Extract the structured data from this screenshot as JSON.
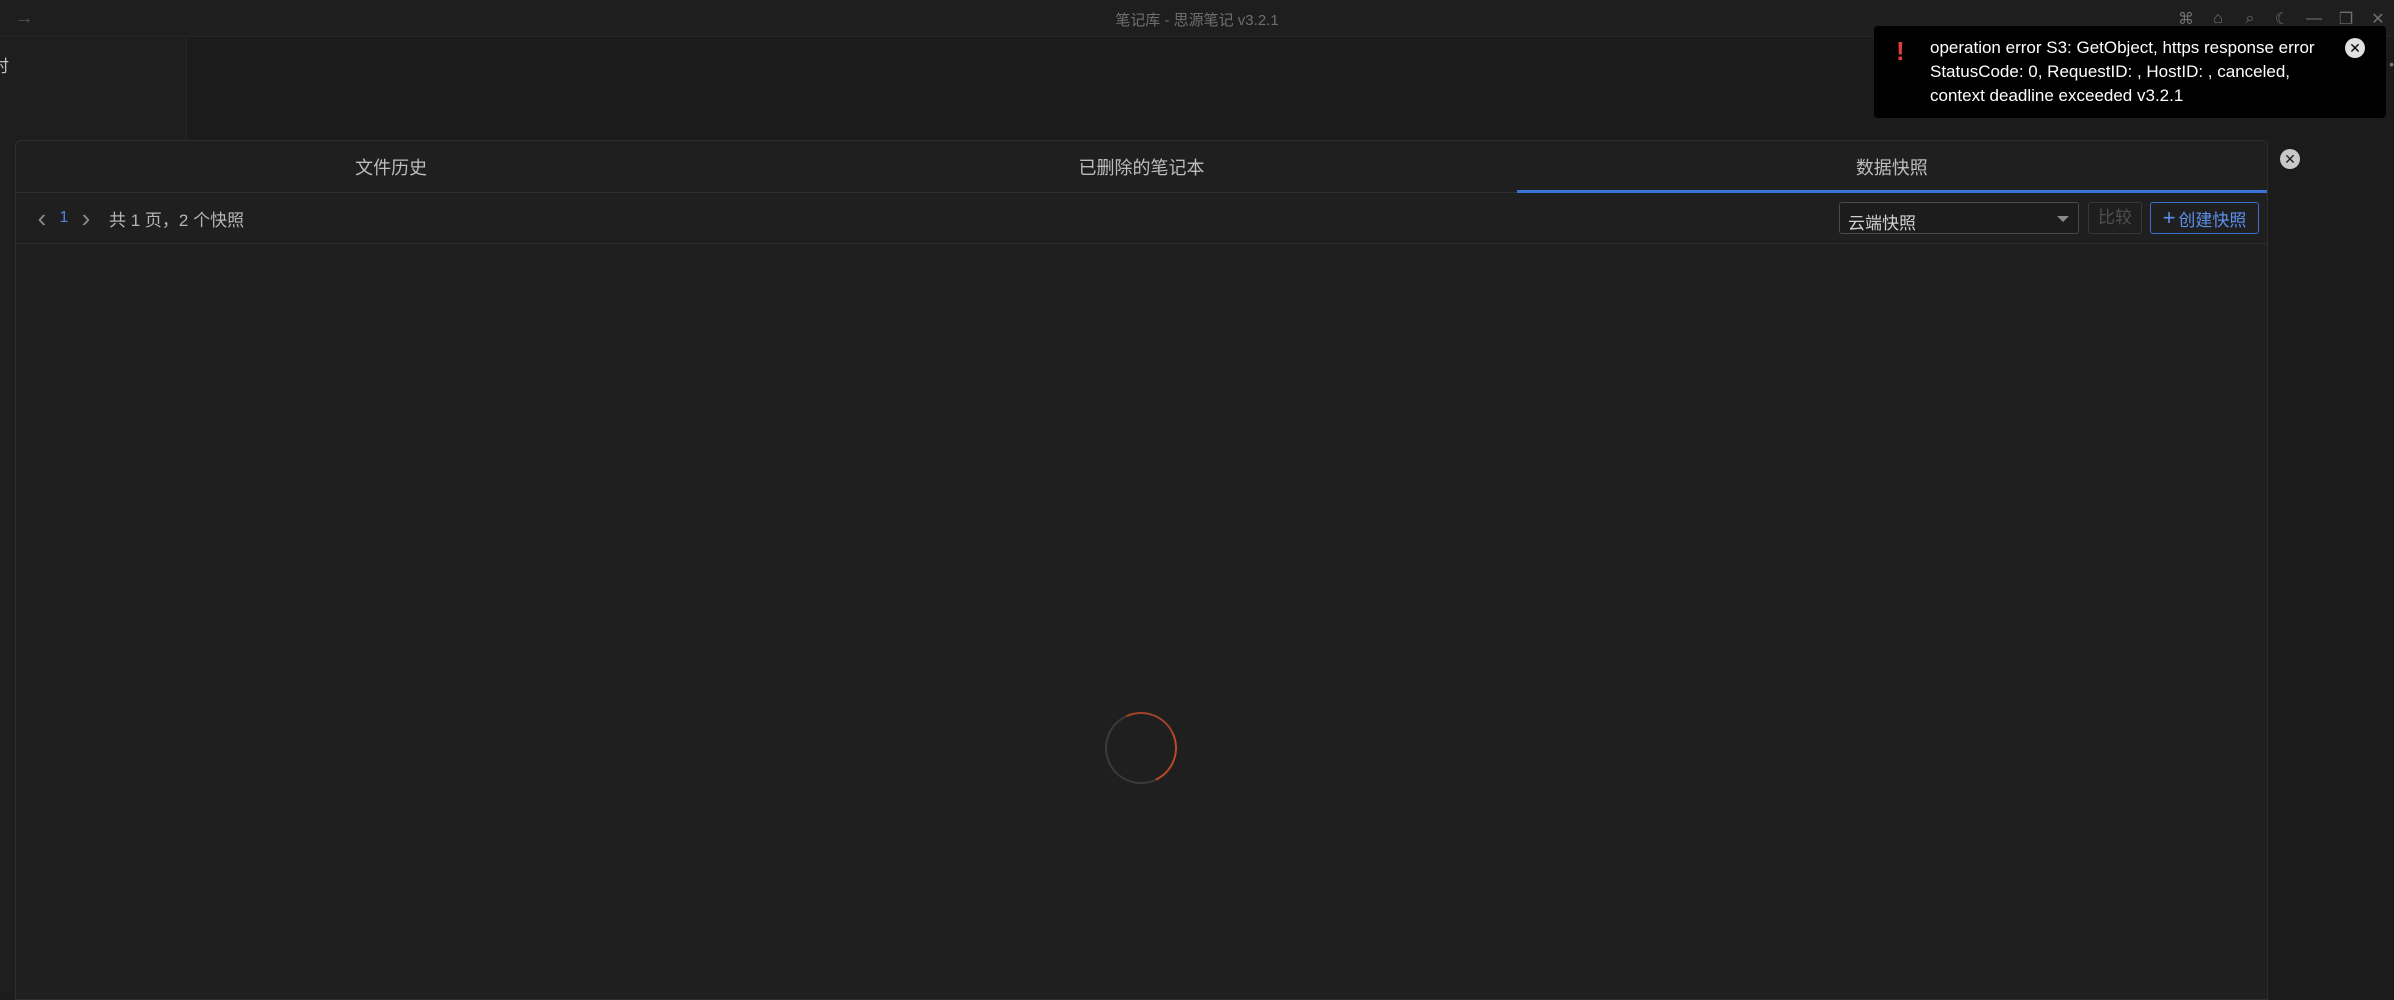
{
  "window": {
    "title": "笔记库 - 思源笔记 v3.2.1",
    "back_icon": "→",
    "icons": [
      "⌘",
      "⌂",
      "⌕",
      "☾",
      "—",
      "❐",
      "✕"
    ]
  },
  "left_panel": {
    "partial_char": "时"
  },
  "right_edge": {
    "partial_char": "•"
  },
  "tabs": [
    {
      "label": "文件历史",
      "active": false
    },
    {
      "label": "已删除的笔记本",
      "active": false
    },
    {
      "label": "数据快照",
      "active": true
    }
  ],
  "pager": {
    "prev": "‹",
    "current_page": "1",
    "next": "›",
    "summary": "共 1 页，2 个快照"
  },
  "toolbar": {
    "select_value": "云端快照",
    "compare_label": "比较",
    "create_plus": "+",
    "create_label": "创建快照"
  },
  "dialog_close": "✕",
  "toast": {
    "icon": "!",
    "message": "operation error S3: GetObject, https response error StatusCode: 0, RequestID: , HostID: , canceled, context deadline exceeded v3.2.1",
    "close": "✕"
  },
  "colors": {
    "accent": "#3b73d9",
    "error": "#e23b3b",
    "spinner": "#b84a2a"
  }
}
